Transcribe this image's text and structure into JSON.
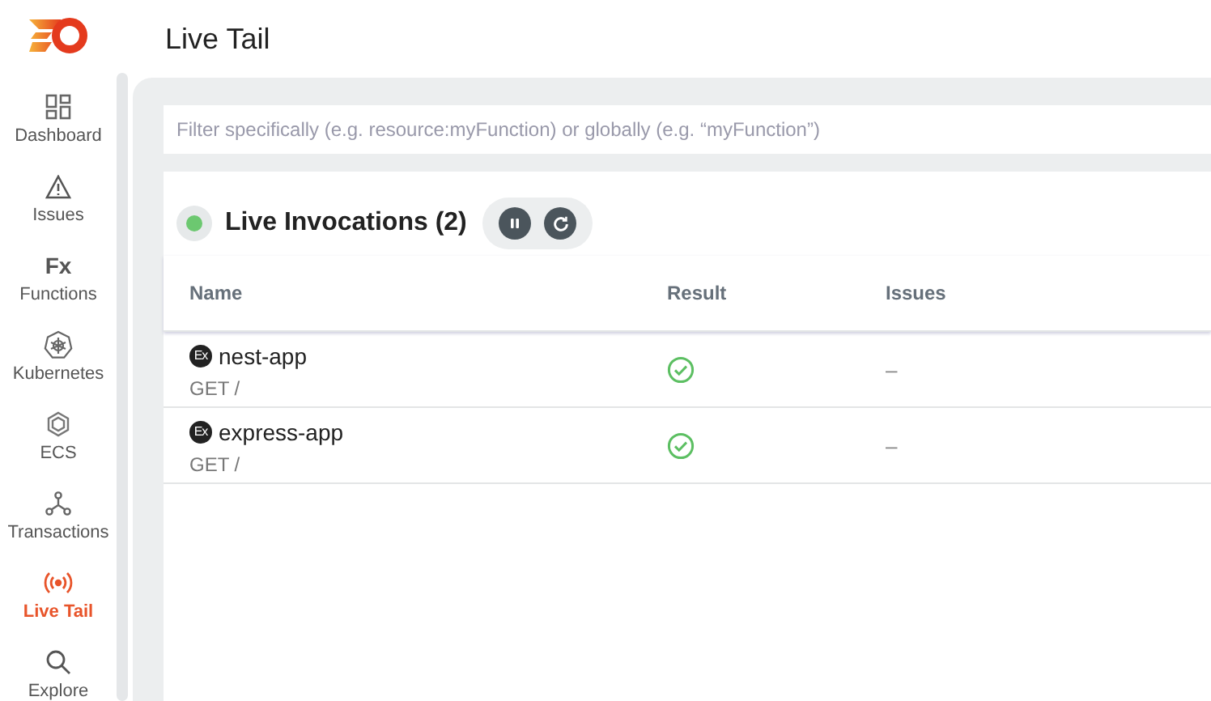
{
  "header": {
    "title": "Live Tail"
  },
  "sidebar": {
    "items": [
      {
        "label": "Dashboard",
        "selected": false
      },
      {
        "label": "Issues",
        "selected": false
      },
      {
        "label": "Functions",
        "glyph": "Fx",
        "selected": false
      },
      {
        "label": "Kubernetes",
        "selected": false
      },
      {
        "label": "ECS",
        "selected": false
      },
      {
        "label": "Transactions",
        "selected": false
      },
      {
        "label": "Live Tail",
        "selected": true
      },
      {
        "label": "Explore",
        "selected": false
      }
    ]
  },
  "filter": {
    "placeholder": "Filter specifically (e.g. resource:myFunction) or globally (e.g. “myFunction”)"
  },
  "panel": {
    "title": "Live Invocations (2)",
    "live": true,
    "paused": false,
    "columns": [
      "Name",
      "Result",
      "Issues"
    ],
    "rows": [
      {
        "kind": "success",
        "badge": "Ex",
        "name": "nest-app",
        "method": "GET /",
        "issues": "–"
      },
      {
        "kind": "success",
        "badge": "Ex",
        "name": "express-app",
        "method": "GET /",
        "issues": "–"
      }
    ]
  }
}
